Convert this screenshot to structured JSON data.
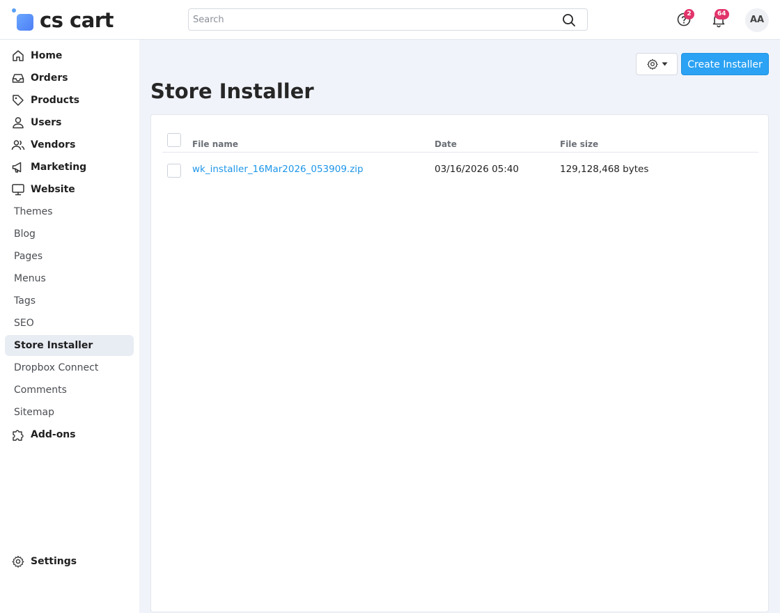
{
  "header": {
    "logo_text": "cs cart",
    "search": {
      "placeholder": "Search",
      "value": ""
    },
    "help_badge": "2",
    "notifications_badge": "64",
    "avatar_initials": "AA"
  },
  "sidebar": {
    "items": [
      {
        "label": "Home",
        "icon": "home-icon"
      },
      {
        "label": "Orders",
        "icon": "inbox-icon"
      },
      {
        "label": "Products",
        "icon": "tag-icon"
      },
      {
        "label": "Users",
        "icon": "user-icon"
      },
      {
        "label": "Vendors",
        "icon": "users-icon"
      },
      {
        "label": "Marketing",
        "icon": "megaphone-icon"
      },
      {
        "label": "Website",
        "icon": "monitor-icon"
      }
    ],
    "website_submenu": [
      "Themes",
      "Blog",
      "Pages",
      "Menus",
      "Tags",
      "SEO",
      "Store Installer",
      "Dropbox Connect",
      "Comments",
      "Sitemap"
    ],
    "active_item": "Store Installer",
    "addons_label": "Add-ons",
    "settings_label": "Settings"
  },
  "toolbar": {
    "create_label": "Create Installer",
    "accent_color": "#2ba2f3"
  },
  "page": {
    "title": "Store Installer"
  },
  "table": {
    "columns": [
      "File name",
      "Date",
      "File size"
    ],
    "rows": [
      {
        "file_name": "wk_installer_16Mar2026_053909.zip",
        "date": "03/16/2026 05:40",
        "size": "129,128,468 bytes"
      }
    ]
  }
}
